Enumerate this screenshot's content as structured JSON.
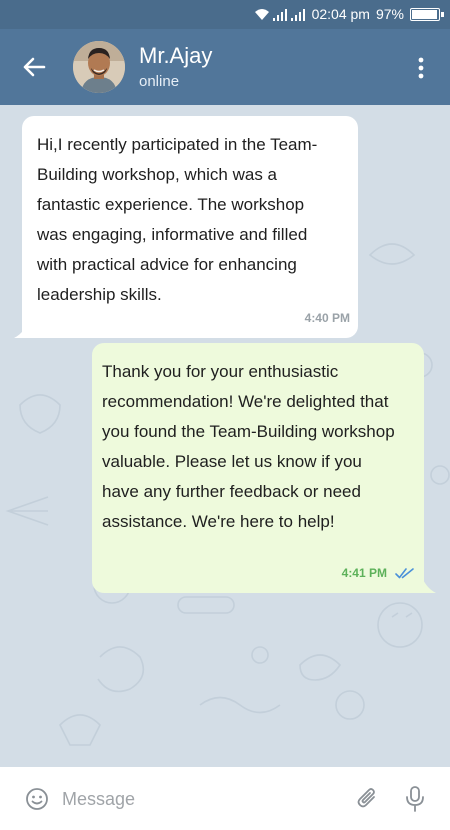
{
  "status_bar": {
    "time": "02:04 pm",
    "battery": "97%",
    "battery_level": 0.97
  },
  "header": {
    "contact_name": "Mr.Ajay",
    "status": "online",
    "icons": [
      "back-arrow-icon",
      "avatar",
      "more-vert-icon"
    ]
  },
  "messages": [
    {
      "direction": "incoming",
      "lines": [
        "Hi,I recently participated in the Team-",
        "Building workshop, which was a",
        "fantastic experience. The workshop",
        "was engaging, informative and filled",
        "with practical advice for enhancing",
        "leadership skills."
      ],
      "time": "4:40 PM"
    },
    {
      "direction": "outgoing",
      "lines": [
        "Thank you for your enthusiastic",
        "recommendation! We're delighted that",
        "you found the Team-Building workshop",
        "valuable. Please let us know if you",
        "have any further feedback or need",
        "assistance. We're here to help!"
      ],
      "time": "4:41 PM",
      "read_receipt": "double-check-icon"
    }
  ],
  "composer": {
    "placeholder": "Message",
    "icons": [
      "emoji-icon",
      "attach-icon",
      "mic-icon"
    ]
  },
  "colors": {
    "header": "#51769a",
    "status_bar": "#4a6c8c",
    "chat_bg": "#d3dde6",
    "incoming_bubble": "#ffffff",
    "outgoing_bubble": "#eefadc",
    "outgoing_time": "#5db15a"
  }
}
